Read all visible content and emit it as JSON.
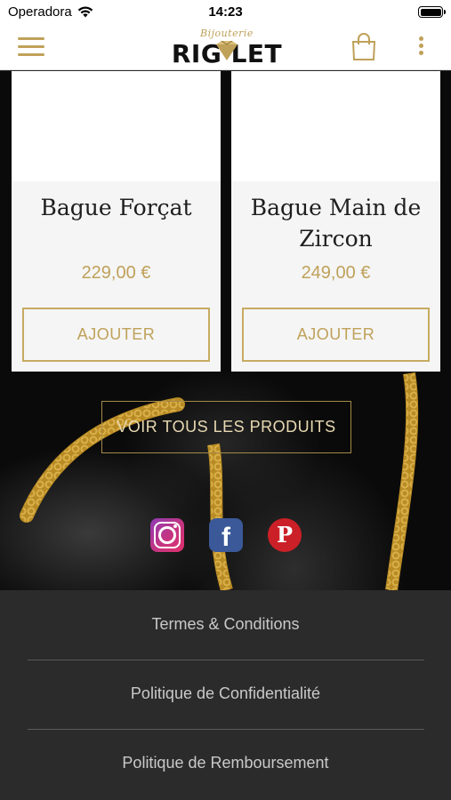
{
  "status_bar": {
    "carrier": "Operadora",
    "time": "14:23"
  },
  "header": {
    "logo_script": "Bijouterie",
    "logo_text": "RIG LET",
    "icons": [
      "menu-icon",
      "diamond-icon",
      "shopping-bag-icon",
      "more-vertical-icon"
    ]
  },
  "products": [
    {
      "name": "Bague Forçat",
      "price": "229,00 €",
      "button": "AJOUTER"
    },
    {
      "name": "Bague Main de Zircon",
      "price": "249,00 €",
      "button": "AJOUTER"
    }
  ],
  "view_all_label": "VOIR TOUS LES PRODUITS",
  "social": [
    "instagram-icon",
    "facebook-icon",
    "pinterest-icon"
  ],
  "footer": {
    "links": [
      "Termes & Conditions",
      "Politique de Confidentialité",
      "Politique de Remboursement"
    ]
  },
  "colors": {
    "gold": "#bfa15a",
    "footer_bg": "#2b2b2b",
    "card_bg": "#f5f5f5"
  }
}
